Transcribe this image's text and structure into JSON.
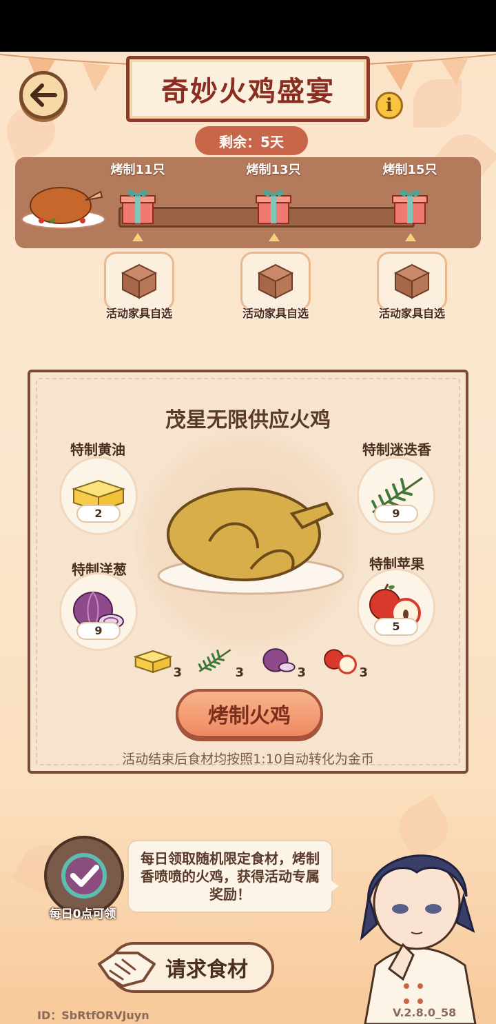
{
  "header": {
    "title": "奇妙火鸡盛宴",
    "remaining": "剩余：5天",
    "back_icon": "arrow-left-icon",
    "info_icon": "info-icon"
  },
  "progress": {
    "milestones": [
      {
        "label": "烤制11只",
        "reward": "活动家具自选"
      },
      {
        "label": "烤制13只",
        "reward": "活动家具自选"
      },
      {
        "label": "烤制15只",
        "reward": "活动家具自选"
      }
    ],
    "fill": 0
  },
  "main": {
    "title": "茂星无限供应火鸡",
    "ingredients": [
      {
        "name": "特制黄油",
        "count": "2",
        "icon": "butter-icon"
      },
      {
        "name": "特制迷迭香",
        "count": "9",
        "icon": "rosemary-icon"
      },
      {
        "name": "特制洋葱",
        "count": "9",
        "icon": "onion-icon"
      },
      {
        "name": "特制苹果",
        "count": "5",
        "icon": "apple-icon"
      }
    ],
    "requirements": [
      {
        "icon": "butter-icon",
        "count": "3"
      },
      {
        "icon": "rosemary-icon",
        "count": "3"
      },
      {
        "icon": "onion-icon",
        "count": "3"
      },
      {
        "icon": "apple-icon",
        "count": "3"
      }
    ],
    "roast_button": "烤制火鸡",
    "footer_note": "活动结束后食材均按照1:10自动转化为金币"
  },
  "daily": {
    "label": "每日0点可领",
    "speech": "每日领取随机限定食材，烤制香喷喷的火鸡，获得活动专属奖励！",
    "request_button": "请求食材"
  },
  "footer": {
    "id": "ID：SbRtfORVJuyn",
    "version": "V.2.8.0_58"
  },
  "colors": {
    "title_text": "#8b2e22",
    "frame": "#7b4a34",
    "button_orange": "#ef8a63"
  }
}
